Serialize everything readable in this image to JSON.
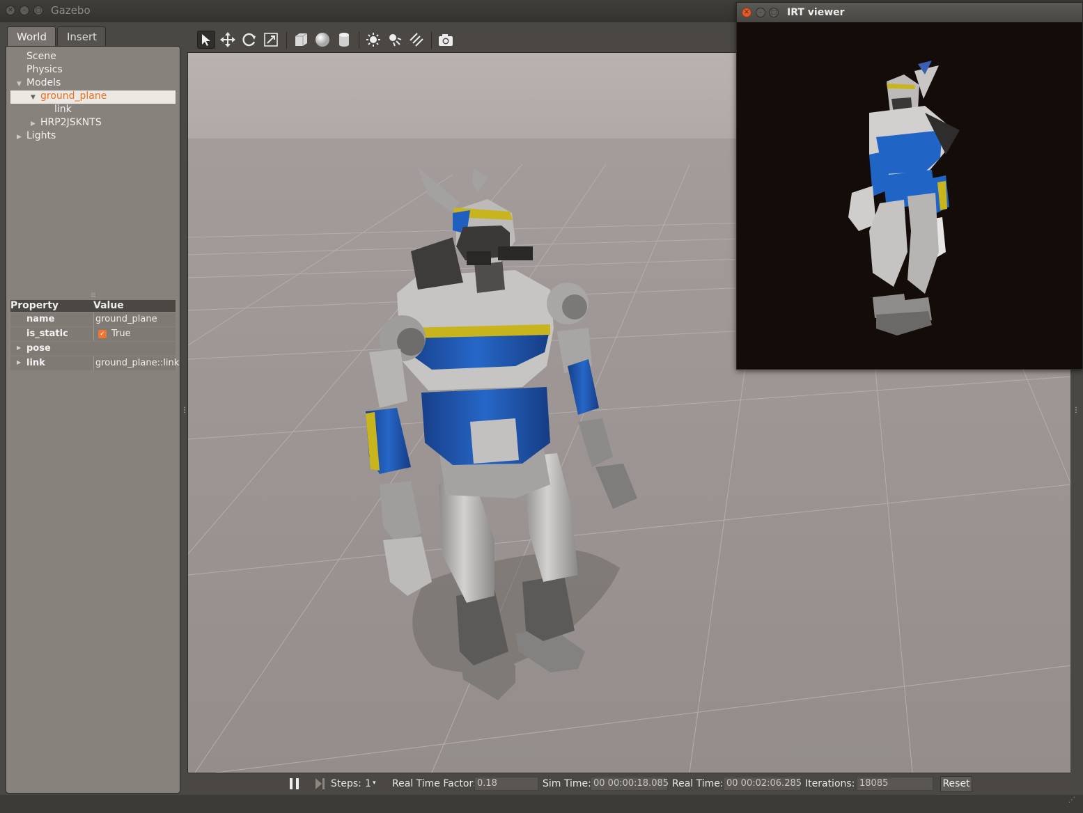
{
  "main_window": {
    "title": "Gazebo",
    "controls": [
      "close-icon",
      "minimize-icon",
      "maximize-icon"
    ]
  },
  "left_panel": {
    "tabs": [
      {
        "label": "World",
        "selected": true
      },
      {
        "label": "Insert",
        "selected": false
      }
    ],
    "tree": {
      "scene": "Scene",
      "physics": "Physics",
      "models": "Models",
      "ground_plane": "ground_plane",
      "link": "link",
      "hrp2": "HRP2JSKNTS",
      "lights": "Lights"
    },
    "properties": {
      "header_property": "Property",
      "header_value": "Value",
      "rows": [
        {
          "key": "name",
          "value": "ground_plane"
        },
        {
          "key": "is_static",
          "value": "True",
          "checked": true
        },
        {
          "key": "pose",
          "value": ""
        },
        {
          "key": "link",
          "value": "ground_plane::link"
        }
      ]
    }
  },
  "toolbar": {
    "tools": [
      {
        "name": "select-mode",
        "icon": "arrow-cursor-icon",
        "active": true
      },
      {
        "name": "translate-mode",
        "icon": "move-arrows-icon"
      },
      {
        "name": "rotate-mode",
        "icon": "rotate-icon"
      },
      {
        "name": "scale-mode",
        "icon": "scale-icon"
      },
      {
        "name": "box-shape",
        "icon": "box-icon"
      },
      {
        "name": "sphere-shape",
        "icon": "sphere-icon"
      },
      {
        "name": "cylinder-shape",
        "icon": "cylinder-icon"
      },
      {
        "name": "point-light",
        "icon": "sun-icon"
      },
      {
        "name": "spot-light",
        "icon": "spotlight-icon"
      },
      {
        "name": "directional-light",
        "icon": "directional-light-icon"
      },
      {
        "name": "screenshot",
        "icon": "camera-icon"
      }
    ]
  },
  "bottom_bar": {
    "steps_label": "Steps:",
    "steps_value": "1",
    "rtf_label": "Real Time Factor:",
    "rtf_value": "0.18",
    "sim_time_label": "Sim Time:",
    "sim_time_value": "00 00:00:18.085",
    "real_time_label": "Real Time:",
    "real_time_value": "00 00:02:06.285",
    "iterations_label": "Iterations:",
    "iterations_value": "18085",
    "reset_label": "Reset"
  },
  "irt_viewer": {
    "title": "IRT viewer"
  },
  "colors": {
    "selection_text": "#e8701f",
    "robot_blue": "#1e5fc0",
    "robot_yellow": "#c8b41c",
    "robot_gray": "#b9b7b5",
    "ground": "#9c9593",
    "sky": "#b3acaa",
    "irt_background": "#130c09"
  }
}
